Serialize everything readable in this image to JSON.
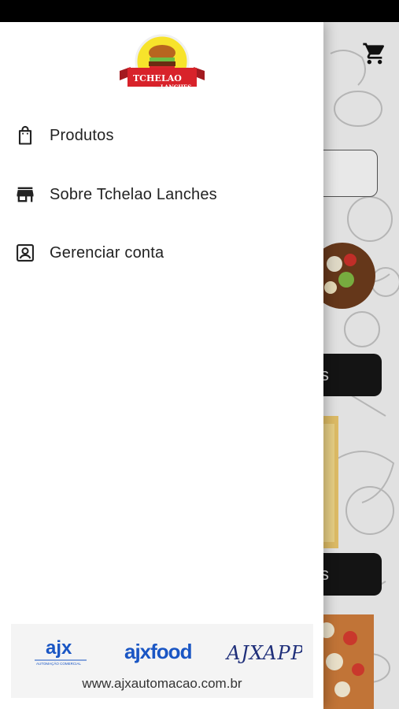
{
  "drawer": {
    "logo_alt": "Tchelao Lanches",
    "logo_text": [
      "TCHE",
      "LAO",
      "LANCHES"
    ],
    "menu": [
      {
        "label": "Produtos",
        "icon": "shopping-bag-icon"
      },
      {
        "label": "Sobre Tchelao Lanches",
        "icon": "store-icon"
      },
      {
        "label": "Gerenciar conta",
        "icon": "account-box-icon"
      }
    ],
    "footer": {
      "brands": [
        "ajx",
        "ajxfood",
        "AJXAPP"
      ],
      "ajx_tagline": "AUTOMAÇÃO COMERCIAL",
      "url": "www.ajxautomacao.com.br"
    }
  },
  "background": {
    "cart_icon": "cart-icon",
    "button_1_label": "s",
    "button_2_label": "s"
  },
  "colors": {
    "drawer_bg": "#ffffff",
    "logo_red": "#d8222a",
    "logo_yellow": "#f7e32b",
    "brand_blue": "#1a56c4",
    "dark_button": "#151515"
  }
}
